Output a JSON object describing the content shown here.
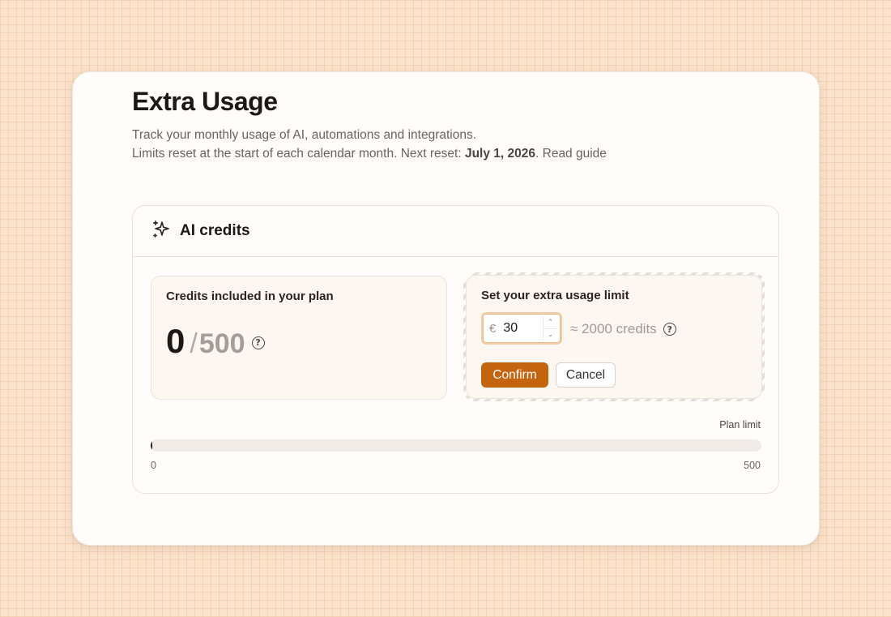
{
  "page": {
    "title": "Extra Usage",
    "description_line1": "Track your monthly usage of AI, automations and integrations.",
    "description_line2_prefix": "Limits reset at the start of each calendar month. Next reset: ",
    "next_reset_date": "July 1, 2026",
    "description_line2_sep": ".",
    "read_guide_link": "Read guide"
  },
  "ai_credits": {
    "icon": "sparkles-icon",
    "title": "AI credits",
    "included": {
      "label": "Credits included in your plan",
      "used": "0",
      "slash": "/",
      "total": "500",
      "help_icon": "?"
    },
    "extra_limit": {
      "label": "Set your extra usage limit",
      "currency_symbol": "€",
      "amount": "30",
      "approx_credits": "≈ 2000 credits",
      "help_icon": "?",
      "confirm_label": "Confirm",
      "cancel_label": "Cancel"
    },
    "progress": {
      "plan_limit_label": "Plan limit",
      "min_label": "0",
      "max_label": "500",
      "fill_fraction": 0.0
    }
  },
  "colors": {
    "accent": "#c4640f",
    "background": "#fbe3cc"
  }
}
